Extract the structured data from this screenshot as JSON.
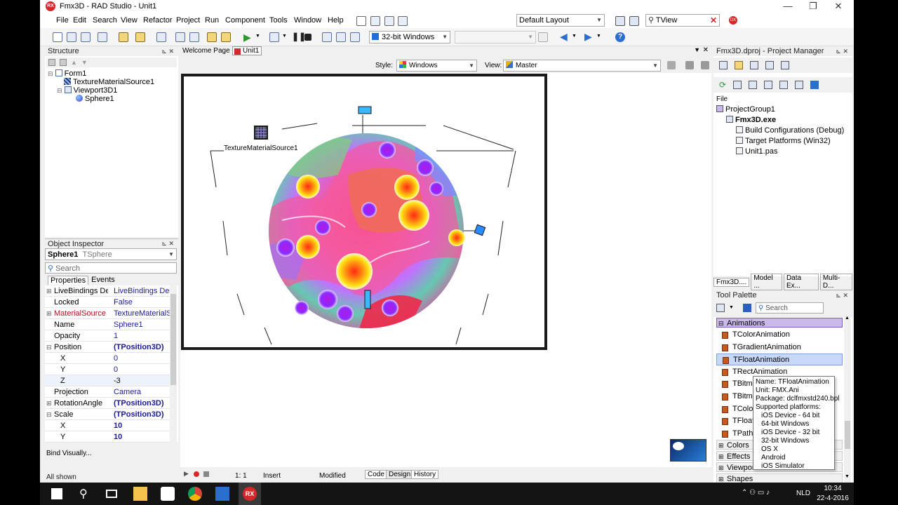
{
  "window": {
    "title": "Fmx3D - RAD Studio - Unit1",
    "logo_text": "RX",
    "minimize": "—",
    "maximize": "❐",
    "close": "✕"
  },
  "menu": {
    "items": [
      "File",
      "Edit",
      "Search",
      "View",
      "Refactor",
      "Project",
      "Run",
      "Component",
      "Tools",
      "Window",
      "Help"
    ],
    "layout_combo": "Default Layout",
    "search_value": "TView"
  },
  "toolbar": {
    "platform_combo": "32-bit Windows"
  },
  "structure": {
    "title": "Structure",
    "tree": [
      {
        "label": "Form1",
        "indent": 0
      },
      {
        "label": "TextureMaterialSource1",
        "indent": 1
      },
      {
        "label": "Viewport3D1",
        "indent": 1
      },
      {
        "label": "Sphere1",
        "indent": 2
      }
    ]
  },
  "object_inspector": {
    "title": "Object Inspector",
    "selected_name": "Sphere1",
    "selected_type": "TSphere",
    "search_placeholder": "Search",
    "tabs": [
      "Properties",
      "Events"
    ],
    "rows": [
      {
        "key": "LiveBindings Desig",
        "value": "LiveBindings Designe",
        "plus": "⊞"
      },
      {
        "key": "Locked",
        "value": "False",
        "plus": ""
      },
      {
        "key": "MaterialSource",
        "value": "TextureMaterialSo",
        "plus": "⊞"
      },
      {
        "key": "Name",
        "value": "Sphere1",
        "plus": ""
      },
      {
        "key": "Opacity",
        "value": "1",
        "plus": ""
      },
      {
        "key": "Position",
        "value": "(TPosition3D)",
        "plus": "⊟"
      },
      {
        "key": "X",
        "value": "0",
        "plus": ""
      },
      {
        "key": "Y",
        "value": "0",
        "plus": ""
      },
      {
        "key": "Z",
        "value": "-3",
        "plus": ""
      },
      {
        "key": "Projection",
        "value": "Camera",
        "plus": ""
      },
      {
        "key": "RotationAngle",
        "value": "(TPosition3D)",
        "plus": "⊞"
      },
      {
        "key": "Scale",
        "value": "(TPosition3D)",
        "plus": "⊟"
      },
      {
        "key": "X",
        "value": "10",
        "plus": ""
      },
      {
        "key": "Y",
        "value": "10",
        "plus": ""
      }
    ],
    "bind_visually": "Bind Visually...",
    "all_shown": "All shown"
  },
  "editor": {
    "tabs": [
      "Welcome Page",
      "Unit1"
    ],
    "style_label": "Style:",
    "style_value": "Windows",
    "view_label": "View:",
    "view_value": "Master",
    "component_label": "TextureMaterialSource1"
  },
  "status": {
    "position": "1:  1",
    "mode": "Insert",
    "modified": "Modified",
    "tabs": [
      "Code",
      "Design",
      "History"
    ]
  },
  "project_manager": {
    "title": "Fmx3D.dproj - Project Manager",
    "file_label": "File",
    "tree": [
      {
        "label": "ProjectGroup1",
        "indent": 0,
        "bold": false
      },
      {
        "label": "Fmx3D.exe",
        "indent": 1,
        "bold": true
      },
      {
        "label": "Build Configurations (Debug)",
        "indent": 2,
        "bold": false
      },
      {
        "label": "Target Platforms (Win32)",
        "indent": 2,
        "bold": false
      },
      {
        "label": "Unit1.pas",
        "indent": 2,
        "bold": false
      }
    ],
    "bottom_tabs": [
      "Fmx3D....",
      "Model ...",
      "Data Ex...",
      "Multi-D..."
    ]
  },
  "tool_palette": {
    "title": "Tool Palette",
    "search_placeholder": "Search",
    "category": "Animations",
    "items": [
      "TColorAnimation",
      "TGradientAnimation",
      "TFloatAnimation",
      "TRectAnimation",
      "TBitma",
      "TBitma",
      "TColorK",
      "TFloatK",
      "TPathA"
    ],
    "selected_index": 2,
    "other_categories": [
      "Colors",
      "Effects",
      "Viewports",
      "Shapes"
    ]
  },
  "tooltip": {
    "lines": [
      "Name: TFloatAnimation",
      "Unit: FMX.Ani",
      "Package: dclfmxstd240.bpl",
      "Supported platforms:"
    ],
    "platforms": [
      "iOS Device - 64 bit",
      "64-bit Windows",
      "iOS Device - 32 bit",
      "32-bit Windows",
      "OS X",
      "Android",
      "iOS Simulator"
    ]
  },
  "taskbar": {
    "clock_time": "10:34",
    "clock_date": "22-4-2016",
    "language": "NLD"
  },
  "colors": {
    "accent_selection": "#c8d8f8",
    "category_header": "#c9b8e8",
    "form_border": "#1a1a1a",
    "taskbar": "#141414"
  }
}
